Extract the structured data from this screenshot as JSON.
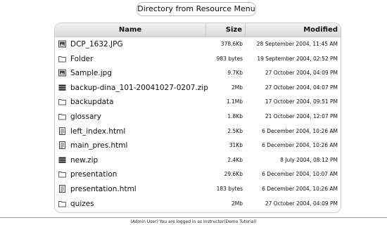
{
  "title": "Directory from Resource Menu",
  "columns": {
    "name": "Name",
    "size": "Size",
    "modified": "Modified"
  },
  "files": [
    {
      "icon": "image-file-icon",
      "name": "DCP_1632.JPG",
      "size": "378.6Kb",
      "modified": "28 September 2004, 11:45 AM"
    },
    {
      "icon": "folder-icon",
      "name": "Folder",
      "size": "983 bytes",
      "modified": "19 September 2004, 02:52 PM"
    },
    {
      "icon": "image-file-icon",
      "name": "Sample.jpg",
      "size": "9.7Kb",
      "modified": "27 October 2004, 04:09 PM"
    },
    {
      "icon": "archive-file-icon",
      "name": "backup-dina_101-20041027-0207.zip",
      "size": "2Mb",
      "modified": "27 October 2004, 04:07 PM"
    },
    {
      "icon": "folder-icon",
      "name": "backupdata",
      "size": "1.1Mb",
      "modified": "17 October 2004, 09:51 PM"
    },
    {
      "icon": "folder-icon",
      "name": "glossary",
      "size": "1.8Kb",
      "modified": "21 October 2004, 12:07 PM"
    },
    {
      "icon": "document-file-icon",
      "name": "left_index.html",
      "size": "2.5Kb",
      "modified": "6 December 2004, 10:26 AM"
    },
    {
      "icon": "document-file-icon",
      "name": "main_pres.html",
      "size": "31Kb",
      "modified": "6 December 2004, 10:26 AM"
    },
    {
      "icon": "archive-file-icon",
      "name": "new.zip",
      "size": "2.4Kb",
      "modified": "8 July 2004, 08:12 PM"
    },
    {
      "icon": "folder-icon",
      "name": "presentation",
      "size": "29.6Kb",
      "modified": "6 December 2004, 10:07 AM"
    },
    {
      "icon": "document-file-icon",
      "name": "presentation.html",
      "size": "183 bytes",
      "modified": "6 December 2004, 10:26 AM"
    },
    {
      "icon": "folder-icon",
      "name": "quizes",
      "size": "2Mb",
      "modified": "27 October 2004, 04:09 PM"
    }
  ],
  "footer": "(Admin User) You are logged in as Instructor(Demo Tutorial)"
}
